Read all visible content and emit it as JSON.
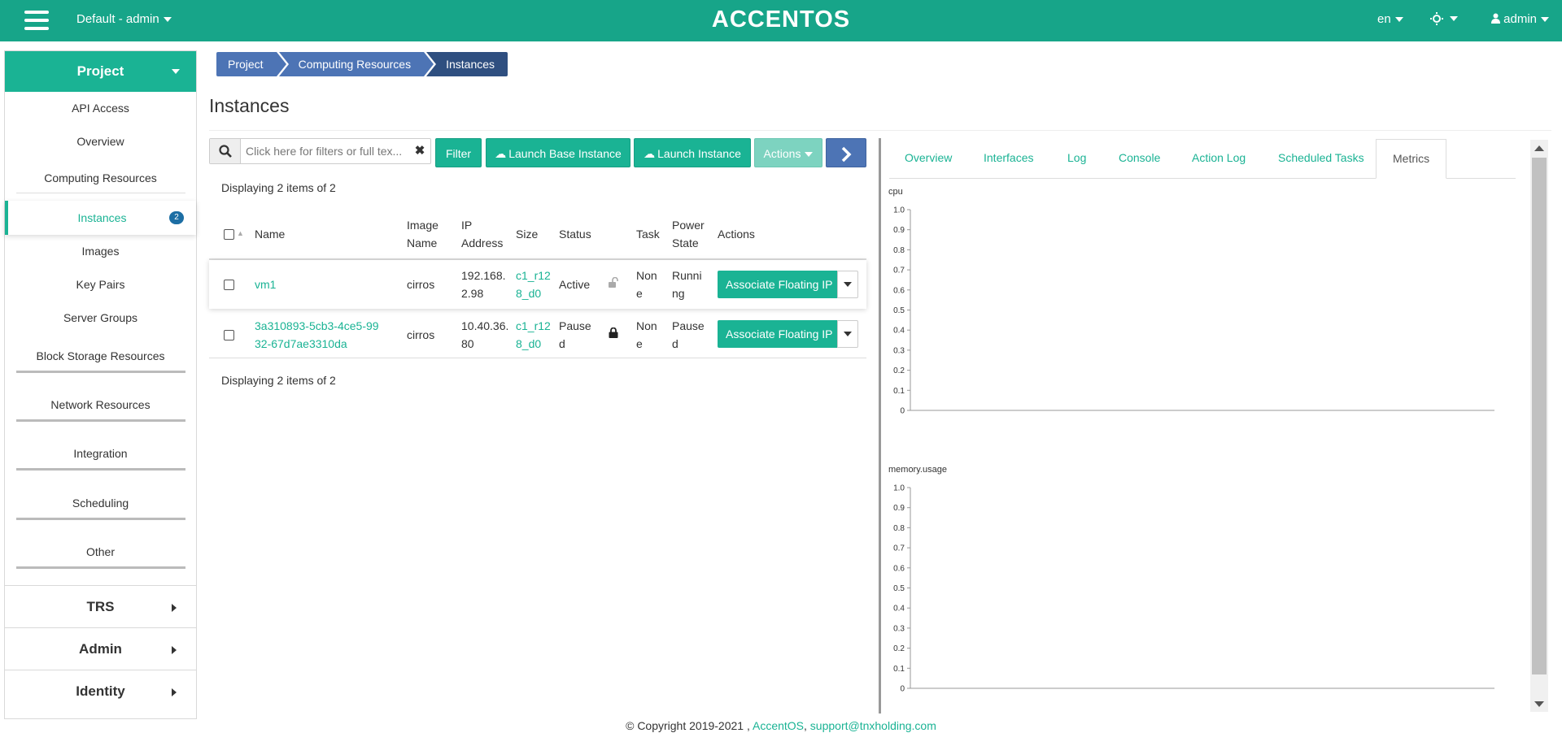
{
  "topbar": {
    "project_select": "Default - admin",
    "logo": "ACCENTOS",
    "lang": "en",
    "user": "admin",
    "bg_color": "#17a589"
  },
  "sidebar": {
    "header": "Project",
    "items": [
      {
        "label": "API Access"
      },
      {
        "label": "Overview"
      }
    ],
    "computing_group": "Computing Resources",
    "computing_items": [
      {
        "label": "Instances",
        "badge": "2"
      },
      {
        "label": "Images"
      },
      {
        "label": "Key Pairs"
      },
      {
        "label": "Server Groups"
      }
    ],
    "groups": [
      "Block Storage Resources",
      "Network Resources",
      "Integration",
      "Scheduling",
      "Other"
    ],
    "sections": [
      "TRS",
      "Admin",
      "Identity"
    ]
  },
  "breadcrumb": [
    "Project",
    "Computing Resources",
    "Instances"
  ],
  "page_title": "Instances",
  "toolbar": {
    "search_placeholder": "Click here for filters or full tex...",
    "filter": "Filter",
    "launch_base": "Launch Base Instance",
    "launch": "Launch Instance",
    "actions": "Actions"
  },
  "display_count": "Displaying 2 items of 2",
  "table": {
    "headers": {
      "name": "Name",
      "image_name_1": "Image",
      "image_name_2": "Name",
      "ip_1": "IP",
      "ip_2": "Address",
      "size": "Size",
      "status": "Status",
      "task": "Task",
      "power_1": "Power",
      "power_2": "State",
      "actions": "Actions"
    },
    "rows": [
      {
        "name_1": "vm1",
        "name_2": "",
        "image": "cirros",
        "ip_1": "192.168.",
        "ip_2": "2.98",
        "size_1": "c1_r12",
        "size_2": "8_d0",
        "status_1": "Active",
        "status_2": "",
        "lock": "unlocked",
        "task_1": "Non",
        "task_2": "e",
        "power_1": "Runni",
        "power_2": "ng",
        "action": "Associate Floating IP"
      },
      {
        "name_1": "3a310893-5cb3-4ce5-99",
        "name_2": "32-67d7ae3310da",
        "image": "cirros",
        "ip_1": "10.40.36.",
        "ip_2": "80",
        "size_1": "c1_r12",
        "size_2": "8_d0",
        "status_1": "Pause",
        "status_2": "d",
        "lock": "locked",
        "task_1": "Non",
        "task_2": "e",
        "power_1": "Pause",
        "power_2": "d",
        "action": "Associate Floating IP"
      }
    ]
  },
  "detail_tabs": [
    "Overview",
    "Interfaces",
    "Log",
    "Console",
    "Action Log",
    "Scheduled Tasks",
    "Metrics"
  ],
  "active_tab": "Metrics",
  "chart_data": [
    {
      "type": "line",
      "title": "cpu",
      "yticks": [
        "1.0",
        "0.9",
        "0.8",
        "0.7",
        "0.6",
        "0.5",
        "0.4",
        "0.3",
        "0.2",
        "0.1",
        "0"
      ],
      "ylim": [
        0,
        1
      ],
      "series": []
    },
    {
      "type": "line",
      "title": "memory.usage",
      "yticks": [
        "1.0",
        "0.9",
        "0.8",
        "0.7",
        "0.6",
        "0.5",
        "0.4",
        "0.3",
        "0.2",
        "0.1",
        "0"
      ],
      "ylim": [
        0,
        1
      ],
      "series": []
    }
  ],
  "footer": {
    "copyright": "© Copyright 2019-2021 ,",
    "brand": "AccentOS",
    "sep": ",",
    "email": "support@tnxholding.com"
  }
}
